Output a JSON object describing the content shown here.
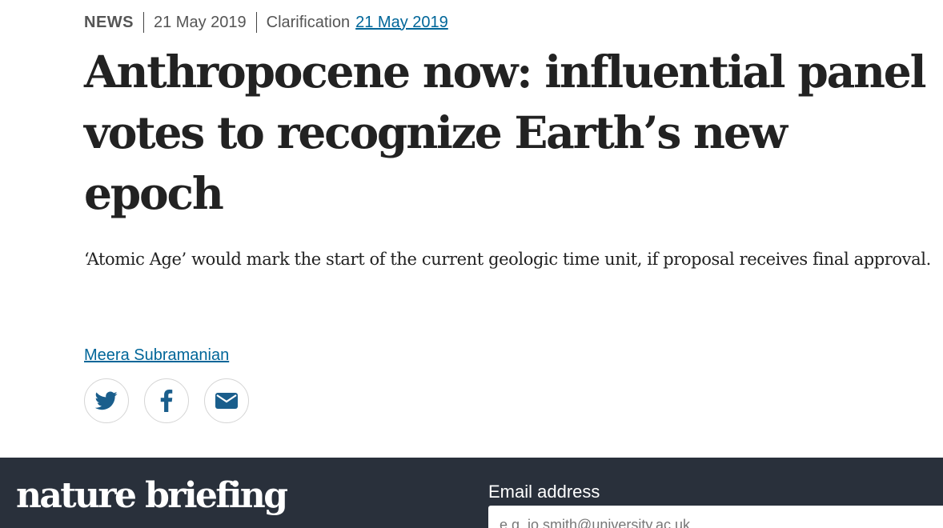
{
  "article": {
    "category": "NEWS",
    "published_date": "21 May 2019",
    "clarification_label": "Clarification",
    "clarification_date": "21 May 2019",
    "headline": "Anthropocene now: influential panel votes to recognize Earth’s new epoch",
    "standfirst": "‘Atomic Age’ would mark the start of the current geologic time unit, if proposal receives final approval.",
    "author": "Meera Subramanian"
  },
  "share": [
    {
      "name": "twitter",
      "icon": "twitter-icon"
    },
    {
      "name": "facebook",
      "icon": "facebook-icon"
    },
    {
      "name": "email",
      "icon": "mail-icon"
    }
  ],
  "briefing": {
    "logo_text": "nature briefing",
    "email_label": "Email address",
    "email_placeholder": "e.g. jo.smith@university.ac.uk",
    "email_value": ""
  },
  "colors": {
    "link": "#006699",
    "text": "#222222",
    "meta": "#555555",
    "briefing_bg": "#29303b",
    "icon": "#1a5e8c"
  }
}
